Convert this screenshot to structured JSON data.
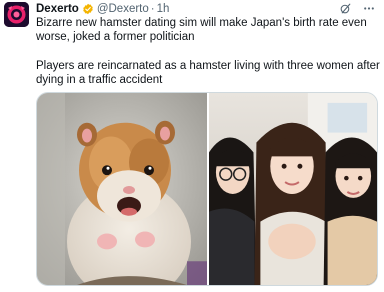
{
  "tweet": {
    "author_name": "Dexerto",
    "handle": "@Dexerto",
    "separator": "·",
    "time": "1h",
    "paragraphs": [
      "Bizarre new hamster dating sim will make Japan's birth rate even worse, joked a former politician",
      "Players are reincarnated as a hamster living with three women after dying in a traffic accident"
    ]
  },
  "icons": {
    "avatar": "dexerto-logo",
    "verified": "verified-badge-icon",
    "grok": "grok-icon",
    "more": "more-icon"
  },
  "colors": {
    "verified": "#f4b400",
    "text": "#0f1419",
    "muted": "#536471"
  },
  "media": {
    "left_image": "hamster-photo",
    "right_image": "three-women-photo"
  }
}
